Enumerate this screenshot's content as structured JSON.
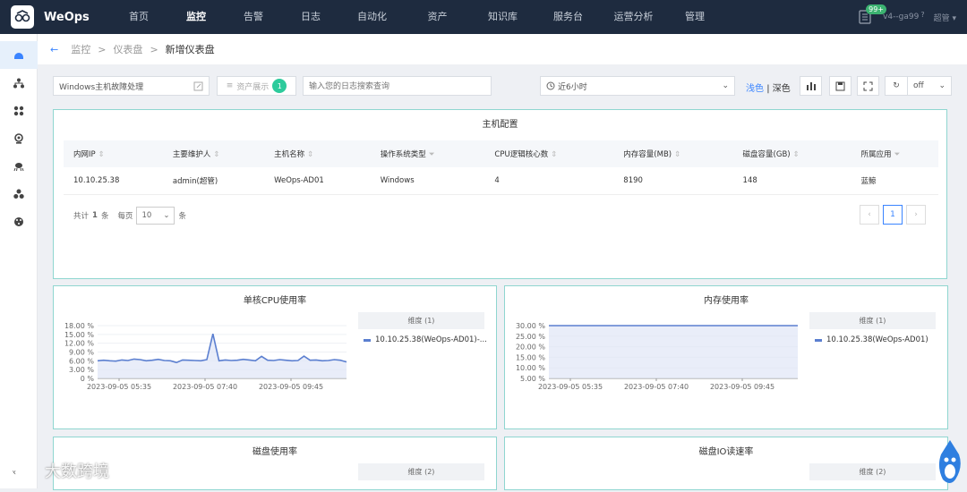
{
  "brand": "WeOps",
  "nav": [
    "首页",
    "监控",
    "告警",
    "日志",
    "自动化",
    "资产",
    "知识库",
    "服务台",
    "运营分析",
    "管理"
  ],
  "nav_active_index": 1,
  "notify_count": "99+",
  "user_id": "v4--ga99",
  "user_role": "超管",
  "breadcrumb": {
    "back": "←",
    "l1": "监控",
    "l2": "仪表盘",
    "current": "新增仪表盘",
    "sep": ">"
  },
  "toolbar": {
    "dashboard_name": "Windows主机故障处理",
    "asset_btn": "资产展示",
    "asset_count": "1",
    "search_placeholder": "输入您的日志搜索查询",
    "time_range": "近6小时",
    "theme_light": "浅色",
    "theme_sep": "|",
    "theme_dark": "深色",
    "refresh_value": "off"
  },
  "host_config": {
    "title": "主机配置",
    "columns": [
      "内网IP",
      "主要维护人",
      "主机名称",
      "操作系统类型",
      "CPU逻辑核心数",
      "内存容量(MB)",
      "磁盘容量(GB)",
      "所属应用"
    ],
    "rows": [
      [
        "10.10.25.38",
        "admin(超管)",
        "WeOps-AD01",
        "Windows",
        "4",
        "8190",
        "148",
        "蓝鲸"
      ]
    ],
    "total_prefix": "共计",
    "total_count": "1",
    "total_suffix": "条",
    "per_page_label": "每页",
    "per_page": "10",
    "per_page_unit": "条",
    "page": "1"
  },
  "cpu_chart": {
    "title": "单核CPU使用率",
    "legend_header": "维度",
    "legend_count": "(1)",
    "legend_item": "10.10.25.38(WeOps-AD01)-...",
    "yticks": [
      "18.00 %",
      "15.00 %",
      "12.00 %",
      "9.00 %",
      "6.00 %",
      "3.00 %",
      "0 %"
    ],
    "xticks": [
      "2023-09-05 05:35",
      "2023-09-05 07:40",
      "2023-09-05 09:45"
    ]
  },
  "mem_chart": {
    "title": "内存使用率",
    "legend_header": "维度",
    "legend_count": "(1)",
    "legend_item": "10.10.25.38(WeOps-AD01)",
    "yticks": [
      "30.00 %",
      "25.00 %",
      "20.00 %",
      "15.00 %",
      "10.00 %",
      "5.00 %"
    ],
    "xticks": [
      "2023-09-05 05:35",
      "2023-09-05 07:40",
      "2023-09-05 09:45"
    ]
  },
  "disk_chart": {
    "title": "磁盘使用率",
    "legend_header": "维度",
    "legend_count": "(2)"
  },
  "io_chart": {
    "title": "磁盘IO读速率",
    "legend_header": "维度",
    "legend_count": "(2)"
  },
  "watermark": "大数跨境",
  "collapse_label": "«"
}
